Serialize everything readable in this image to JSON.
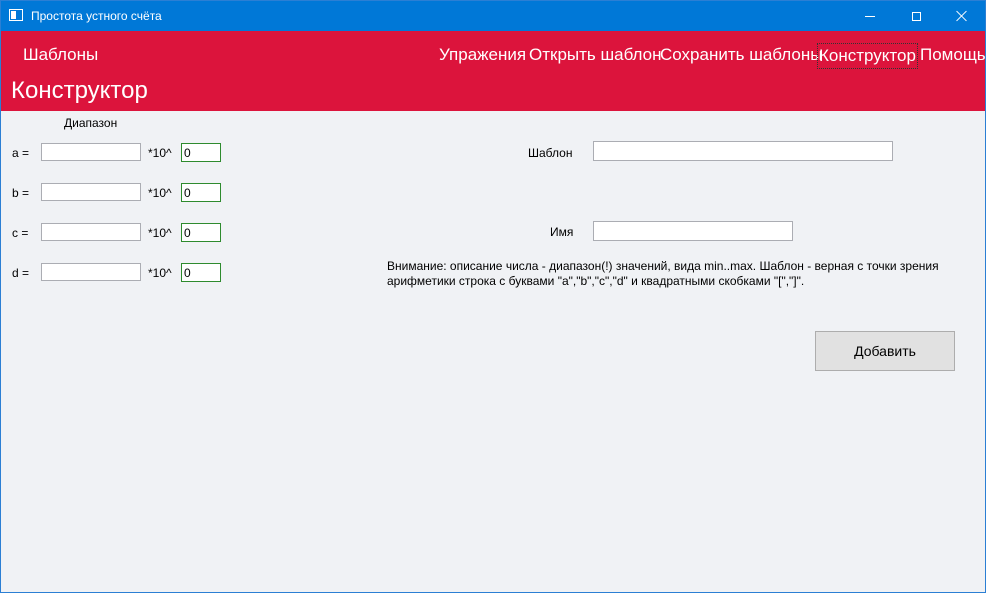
{
  "window": {
    "title": "Простота устного счёта"
  },
  "menu": {
    "templates": "Шаблоны",
    "exercises": "Упражения",
    "open_template": "Открыть шаблон",
    "save_templates": "Сохранить шаблоны",
    "constructor": "Конструктор",
    "help": "Помощь"
  },
  "page": {
    "title": "Конструктор"
  },
  "range": {
    "header": "Диапазон",
    "multiplier": "*10^",
    "rows": [
      {
        "label": "a =",
        "value": "",
        "exponent": "0"
      },
      {
        "label": "b =",
        "value": "",
        "exponent": "0"
      },
      {
        "label": "c =",
        "value": "",
        "exponent": "0"
      },
      {
        "label": "d =",
        "value": "",
        "exponent": "0"
      }
    ]
  },
  "form": {
    "template_label": "Шаблон",
    "template_value": "",
    "name_label": "Имя",
    "name_value": "",
    "note": "Внимание: описание числа - диапазон(!) значений, вида min..max. Шаблон - верная с точки зрения арифметики строка с буквами \"a\",\"b\",\"c\",\"d\" и квадратными скобками \"[\",\"]\".",
    "add_button": "Добавить"
  },
  "icons": {
    "app": "window-app-icon",
    "minimize": "minimize-icon",
    "maximize": "maximize-icon",
    "close": "close-icon"
  },
  "colors": {
    "titlebar": "#0078d7",
    "menubar": "#dc143c",
    "exponent_border": "#2e8b2e"
  }
}
